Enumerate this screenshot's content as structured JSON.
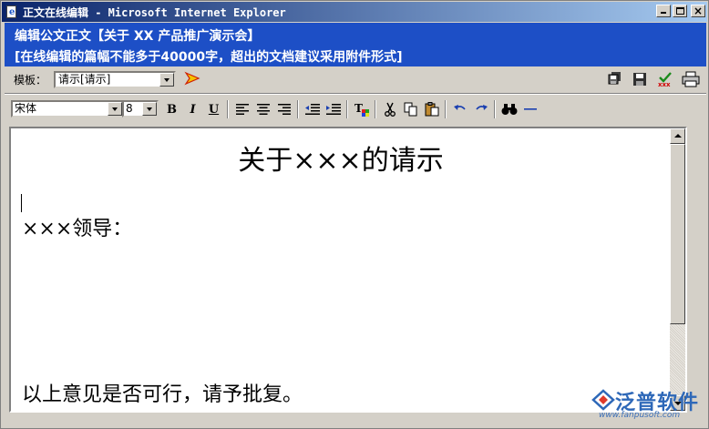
{
  "window": {
    "title": "正文在线编辑 - Microsoft Internet Explorer"
  },
  "heading": {
    "line1": "编辑公文正文【关于  XX 产品推广演示会】",
    "line2": "[在线编辑的篇幅不能多于40000字，超出的文档建议采用附件形式]"
  },
  "template": {
    "label": "模板：",
    "selected": "请示[请示]"
  },
  "format": {
    "font": "宋体",
    "size": "8",
    "bold_label": "B",
    "italic_label": "I",
    "underline_label": "U"
  },
  "document": {
    "title": "关于×××的请示",
    "greeting": "×××领导：",
    "closing": "以上意见是否可行，请予批复。"
  },
  "watermark": {
    "name": "泛普软件",
    "url": "www.fanpusoft.com"
  },
  "colors": {
    "heading_bg": "#1d4fc6",
    "titlebar_start": "#0a246a",
    "titlebar_end": "#a6caf0"
  }
}
